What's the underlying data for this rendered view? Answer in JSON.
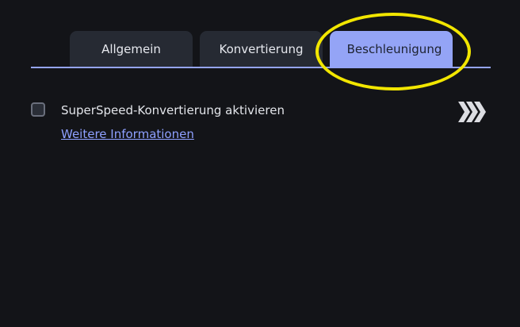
{
  "tabs": [
    {
      "label": "Allgemein",
      "active": false
    },
    {
      "label": "Konvertierung",
      "active": false
    },
    {
      "label": "Beschleunigung",
      "active": true
    }
  ],
  "options": {
    "superspeed": {
      "label": "SuperSpeed-Konvertierung aktivieren",
      "checked": false,
      "link": "Weitere Informationen"
    }
  },
  "icons": {
    "speed": "triple-chevron-right-icon"
  },
  "colors": {
    "background": "#131418",
    "tab_inactive": "#262a33",
    "tab_active": "#94a4f6",
    "link": "#8ea0ff",
    "highlight": "#f2e600"
  }
}
